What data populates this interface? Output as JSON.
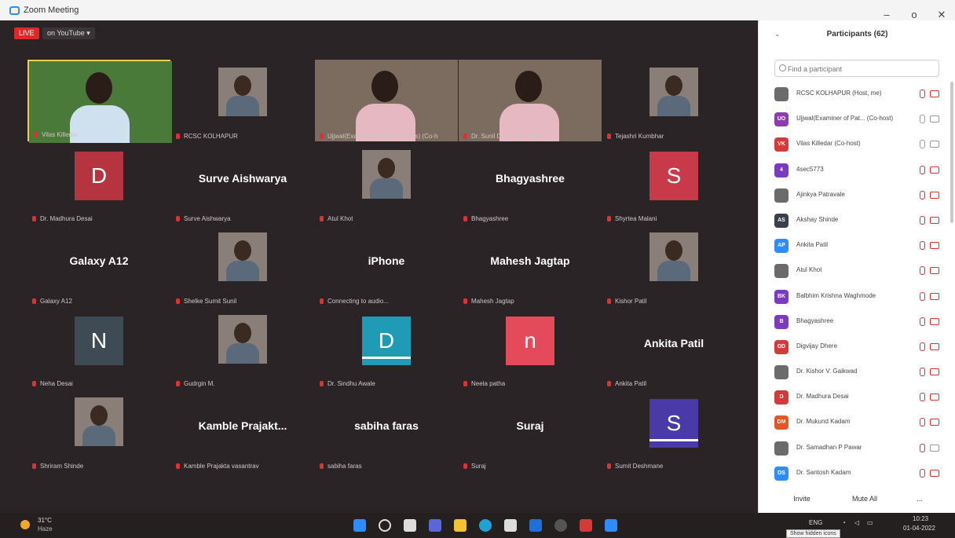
{
  "window": {
    "title": "Zoom Meeting",
    "minimize": "–",
    "maximize": "o",
    "close": "✕"
  },
  "meeting": {
    "live_badge": "LIVE",
    "stream_label": "on YouTube ▾",
    "tiles": [
      {
        "label": "Vilas Killedar",
        "type": "video",
        "active": true
      },
      {
        "label": "RCSC KOLHAPUR",
        "type": "photo"
      },
      {
        "label": "Ujjwal(Examiner of Patents&Des) (Co-h",
        "type": "video"
      },
      {
        "label": "Dr. Sunil Desai (Co-host)",
        "type": "video"
      },
      {
        "label": "Tejashri Kumbhar",
        "type": "photo"
      },
      {
        "label": "Dr. Madhura Desai",
        "type": "avatar",
        "letter": "D",
        "color": "#b5343f"
      },
      {
        "label": "Surve Aishwarya",
        "type": "name",
        "display": "Surve Aishwarya"
      },
      {
        "label": "Atul Khot",
        "type": "photo"
      },
      {
        "label": "Bhagyashree",
        "type": "name",
        "display": "Bhagyashree"
      },
      {
        "label": "Shyrtea Malani",
        "type": "avatar",
        "letter": "S",
        "color": "#c8394a"
      },
      {
        "label": "Galaxy A12",
        "type": "name",
        "display": "Galaxy A12"
      },
      {
        "label": "Shelke Sumit Sunil",
        "type": "photo"
      },
      {
        "label": "Connecting to audio...",
        "type": "name",
        "display": "iPhone"
      },
      {
        "label": "Mahesh Jagtap",
        "type": "name",
        "display": "Mahesh Jagtap"
      },
      {
        "label": "Kishor Patil",
        "type": "photo"
      },
      {
        "label": "Neha Desai",
        "type": "avatar",
        "letter": "N",
        "color": "#3e4a54"
      },
      {
        "label": "Gudrgin M.",
        "type": "photo"
      },
      {
        "label": "Dr. Sindhu Awale",
        "type": "avatar",
        "letter": "D",
        "color": "#1f9bb6",
        "line": true
      },
      {
        "label": "Neela patha",
        "type": "avatar",
        "letter": "n",
        "color": "#e44a5a"
      },
      {
        "label": "Ankita Patil",
        "type": "name",
        "display": "Ankita Patil"
      },
      {
        "label": "Shriram Shinde",
        "type": "photo"
      },
      {
        "label": "Kamble Prajakta vasantrav",
        "type": "name",
        "display": "Kamble  Prajakt..."
      },
      {
        "label": "sabiha faras",
        "type": "name",
        "display": "sabiha faras"
      },
      {
        "label": "Suraj",
        "type": "name",
        "display": "Suraj"
      },
      {
        "label": "Sumit Deshmane",
        "type": "avatar",
        "letter": "S",
        "color": "#4a3aa8",
        "line": true
      }
    ]
  },
  "participants": {
    "title": "Participants (62)",
    "search_placeholder": "Find a participant",
    "list": [
      {
        "initials": "",
        "color": "#6b6b6b",
        "name": "RCSC KOLHAPUR (Host, me)",
        "mic_on": false,
        "cam_on": false
      },
      {
        "initials": "UO",
        "color": "#8e3bb2",
        "name": "Ujjwal(Examiner of Pat... (Co-host)",
        "mic_on": true,
        "cam_on": true
      },
      {
        "initials": "VK",
        "color": "#d33a3a",
        "name": "Vilas Killedar (Co-host)",
        "mic_on": true,
        "cam_on": true
      },
      {
        "initials": "4",
        "color": "#7a3bbf",
        "name": "4sec5773",
        "mic_on": false,
        "cam_on": false
      },
      {
        "initials": "",
        "color": "#6b6b6b",
        "name": "Ajinkya Patravale",
        "mic_on": false,
        "cam_on": false
      },
      {
        "initials": "AS",
        "color": "#3a3f4a",
        "name": "Akshay Shinde",
        "mic_on": false,
        "cam_on": false
      },
      {
        "initials": "AP",
        "color": "#2d8cff",
        "name": "Ankita Patil",
        "mic_on": false,
        "cam_on": false
      },
      {
        "initials": "",
        "color": "#6b6b6b",
        "name": "Atul Khot",
        "mic_on": false,
        "cam_on": false
      },
      {
        "initials": "BK",
        "color": "#7a3bbf",
        "name": "Balbhim Krishna Waghmode",
        "mic_on": false,
        "cam_on": false
      },
      {
        "initials": "B",
        "color": "#7a3bbf",
        "name": "Bhagyashree",
        "mic_on": false,
        "cam_on": false
      },
      {
        "initials": "DD",
        "color": "#d33a3a",
        "name": "Digvijay Dhere",
        "mic_on": false,
        "cam_on": false
      },
      {
        "initials": "",
        "color": "#6b6b6b",
        "name": "Dr. Kishor V. Gaikwad",
        "mic_on": false,
        "cam_on": false
      },
      {
        "initials": "D",
        "color": "#d33a3a",
        "name": "Dr. Madhura Desai",
        "mic_on": false,
        "cam_on": false
      },
      {
        "initials": "DM",
        "color": "#e0572a",
        "name": "Dr. Mukund Kadam",
        "mic_on": false,
        "cam_on": false
      },
      {
        "initials": "",
        "color": "#6b6b6b",
        "name": "Dr. Samadhan P Pawar",
        "mic_on": false,
        "cam_on": true
      },
      {
        "initials": "DS",
        "color": "#2d8cff",
        "name": "Dr. Santosh Kadam",
        "mic_on": false,
        "cam_on": false
      }
    ],
    "invite_label": "Invite",
    "mute_all_label": "Mute All",
    "more_label": "..."
  },
  "taskbar": {
    "temperature": "31°C",
    "weather": "Haze",
    "language": "ENG",
    "time": "10:23",
    "date": "01-04-2022",
    "tooltip": "Show hidden icons"
  }
}
